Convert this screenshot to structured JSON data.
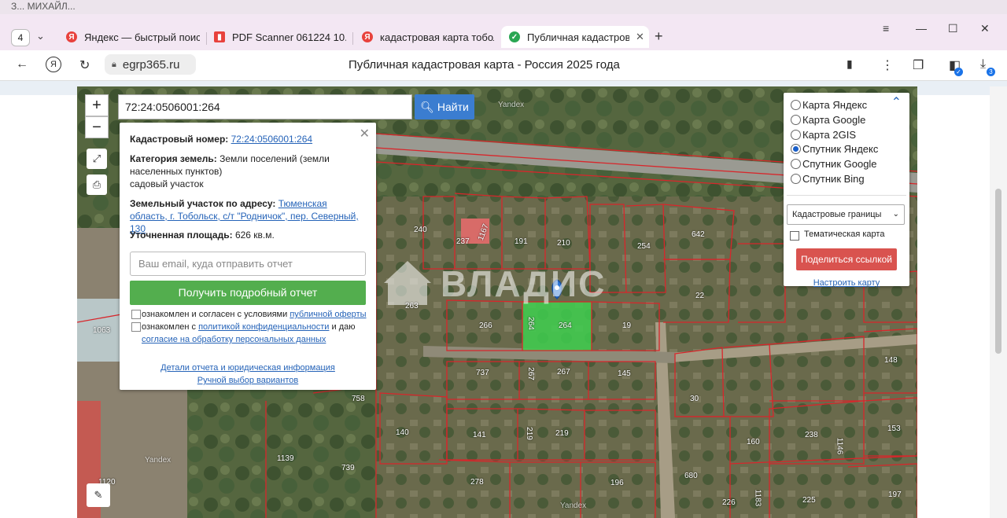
{
  "browser": {
    "bg_window_title": "З... МИХАЙЛ...",
    "tab_count": "4",
    "tabs": [
      {
        "label": "Яндекс — быстрый поиск",
        "icon": "yandex-icon"
      },
      {
        "label": "PDF Scanner 061224 10.38",
        "icon": "pdf-icon"
      },
      {
        "label": "кадастровая карта тобол",
        "icon": "yandex-icon"
      },
      {
        "label": "Публичная кадастров",
        "icon": "check-shield-icon",
        "active": true
      }
    ],
    "address": "egrp365.ru",
    "page_title": "Публичная кадастровая карта - Россия 2025 года",
    "downloads_badge": "3"
  },
  "map": {
    "search_value": "72:24:0506001:264",
    "search_button": "Найти",
    "watermark": "ВЛАДИС",
    "yandex_labels": [
      "Yandex",
      "Yandex",
      "Yandex"
    ],
    "parcel_labels": [
      "240",
      "237",
      "1167",
      "191",
      "210",
      "254",
      "642",
      "263",
      "266",
      "264",
      "264",
      "19",
      "22",
      "1063",
      "737",
      "267",
      "267",
      "145",
      "148",
      "758",
      "140",
      "141",
      "219",
      "219",
      "30",
      "160",
      "238",
      "1146",
      "153",
      "1139",
      "739",
      "278",
      "196",
      "680",
      "226",
      "1183",
      "225",
      "197",
      "1120"
    ]
  },
  "popup": {
    "cadastral_label": "Кадастровый номер:",
    "cadastral_value": "72:24:0506001:264",
    "category_label": "Категория земель:",
    "category_value": "Земли поселений (земли населенных пунктов)",
    "usage": "садовый участок",
    "address_label": "Земельный участок по адресу:",
    "address_value": "Тюменская область, г. Тобольск, с/т \"Родничок\", пер. Северный, 130",
    "area_label": "Уточненная площадь:",
    "area_value": "626 кв.м.",
    "email_placeholder": "Ваш email, куда отправить отчет",
    "get_report": "Получить подробный отчет",
    "agree1_prefix": "ознакомлен и согласен с условиями",
    "agree1_link": "публичной оферты",
    "agree2_prefix": "ознакомлен с",
    "agree2_link": "политикой конфиденциальности",
    "agree2_mid": "и даю",
    "agree2_link2": "согласие на обработку персональных данных",
    "details_link": "Детали отчета и юридическая информация",
    "manual_link": "Ручной выбор вариантов"
  },
  "layers": {
    "options": [
      {
        "label": "Карта Яндекс",
        "selected": false
      },
      {
        "label": "Карта Google",
        "selected": false
      },
      {
        "label": "Карта 2GIS",
        "selected": false
      },
      {
        "label": "Спутник Яндекс",
        "selected": true
      },
      {
        "label": "Спутник Google",
        "selected": false
      },
      {
        "label": "Спутник Bing",
        "selected": false
      }
    ],
    "boundary_select": "Кадастровые границы",
    "thematic_label": "Тематическая карта",
    "share_button": "Поделиться ссылкой",
    "setup_link": "Настроить карту"
  },
  "colors": {
    "highlight_parcel": "#3ecf4f",
    "boundary": "#d8262b",
    "search_button": "#3b7dd0",
    "report_button": "#53ae4e",
    "share_button": "#d9534f"
  }
}
